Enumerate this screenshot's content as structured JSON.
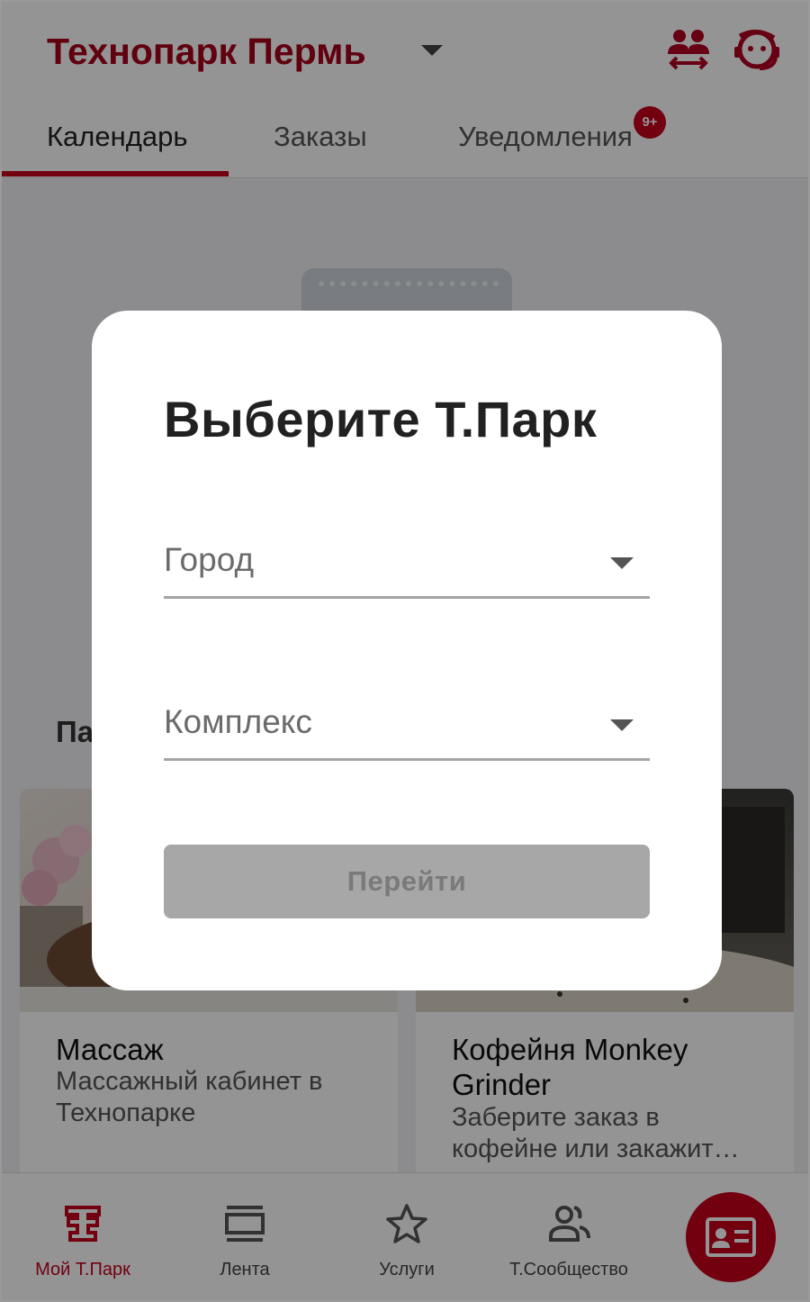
{
  "header": {
    "title": "Технопарк Пермь"
  },
  "tabs": [
    {
      "label": "Календарь",
      "active": true
    },
    {
      "label": "Заказы",
      "active": false
    },
    {
      "label": "Уведомления",
      "active": false,
      "badge": "9+"
    }
  ],
  "section": {
    "title": "Па"
  },
  "cards": [
    {
      "title": "Массаж",
      "description": "Массажный кабинет в Технопарке"
    },
    {
      "title": "Кофейня Monkey Grinder",
      "description": "Заберите заказ в кофейне или закажит…"
    }
  ],
  "bottom_nav": [
    {
      "label": "Мой Т.Парк",
      "icon": "tpark-logo-icon",
      "active": true
    },
    {
      "label": "Лента",
      "icon": "feed-icon",
      "active": false
    },
    {
      "label": "Услуги",
      "icon": "star-icon",
      "active": false
    },
    {
      "label": "Т.Сообщество",
      "icon": "community-icon",
      "active": false
    }
  ],
  "dialog": {
    "title": "Выберите Т.Парк",
    "city_placeholder": "Город",
    "complex_placeholder": "Комплекс",
    "button_label": "Перейти",
    "button_enabled": false
  },
  "colors": {
    "brand_red": "#c4001b",
    "title_red": "#a8001a",
    "disabled_button": "#a7a7a7"
  }
}
